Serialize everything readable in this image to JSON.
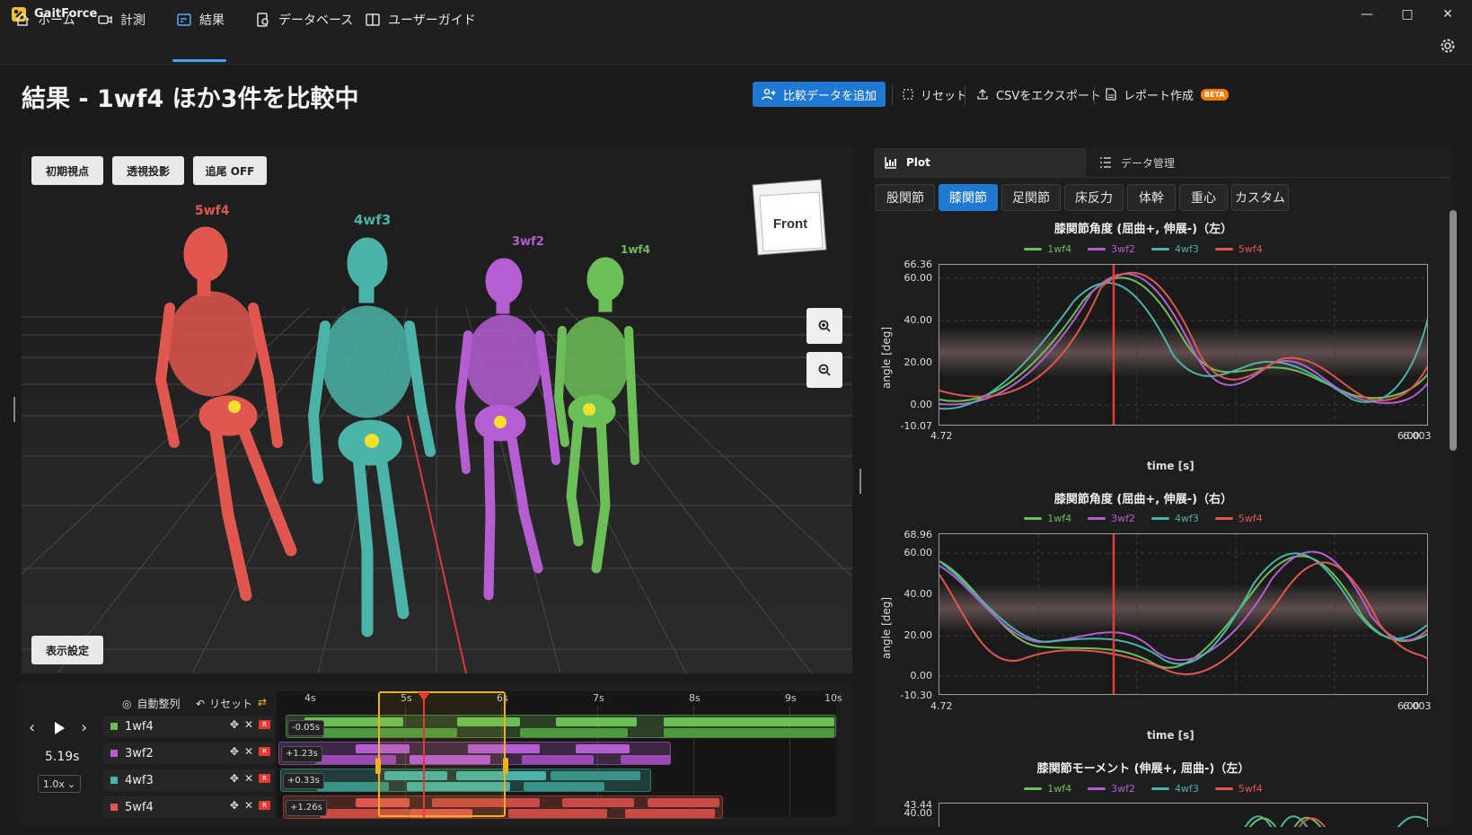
{
  "app": {
    "title": "GaitForce"
  },
  "nav": {
    "home": "ホーム",
    "measure": "計測",
    "results": "結果",
    "database": "データベース",
    "guide": "ユーザーガイド"
  },
  "header": {
    "title": "結果 - 1wf4 ほか3件を比較中",
    "add_compare": "比較データを追加",
    "reset": "リセット",
    "export_csv": "CSVをエクスポート",
    "report": "レポート作成",
    "beta": "BETA"
  },
  "viewport": {
    "initial_view": "初期視点",
    "perspective": "透視投影",
    "follow": "追尾 OFF",
    "display_settings": "表示設定",
    "view_cube_label": "Front",
    "skeletons": [
      {
        "name": "5wf4",
        "color": "#e0574f"
      },
      {
        "name": "4wf3",
        "color": "#4bb3a7"
      },
      {
        "name": "3wf2",
        "color": "#b45ed1"
      },
      {
        "name": "1wf4",
        "color": "#6cbf58"
      }
    ]
  },
  "timeline": {
    "auto_align": "自動整列",
    "reset": "リセット",
    "time": "5.19s",
    "speed": "1.0x",
    "ticks": [
      "4s",
      "5s",
      "6s",
      "7s",
      "8s",
      "9s",
      "10s"
    ],
    "rows": [
      {
        "name": "1wf4",
        "offset": "-0.05s",
        "color": "#6cbf58"
      },
      {
        "name": "3wf2",
        "offset": "+1.23s",
        "color": "#b45ed1"
      },
      {
        "name": "4wf3",
        "offset": "+0.33s",
        "color": "#4bb3a7"
      },
      {
        "name": "5wf4",
        "offset": "+1.26s",
        "color": "#e0574f"
      }
    ],
    "r_badge": "R"
  },
  "panel": {
    "tab_plot": "Plot",
    "tab_data": "データ管理",
    "joints": [
      "股関節",
      "膝関節",
      "足関節",
      "床反力",
      "体幹",
      "重心",
      "カスタム"
    ],
    "active_joint": "膝関節"
  },
  "plots": [
    {
      "title": "膝関節角度 (屈曲+, 伸展-)（左）",
      "ylabel": "angle [deg]",
      "xlabel": "time [s]",
      "yticks": [
        "66.36",
        "60.00",
        "40.00",
        "20.00",
        "0.00",
        "-10.07"
      ],
      "xticks_left": "4.72",
      "xticks_right": "6.003",
      "xticks_overlap": "6.00"
    },
    {
      "title": "膝関節角度 (屈曲+, 伸展-)（右）",
      "ylabel": "angle [deg]",
      "xlabel": "time [s]",
      "yticks": [
        "68.96",
        "60.00",
        "40.00",
        "20.00",
        "0.00",
        "-10.30"
      ],
      "xticks_left": "4.72",
      "xticks_right": "6.003",
      "xticks_overlap": "6.00"
    },
    {
      "title": "膝関節モーメント (伸展+, 屈曲-)（左）",
      "yticks": [
        "43.44",
        "40.00"
      ]
    }
  ],
  "legend": [
    {
      "name": "1wf4",
      "color": "#6cbf58"
    },
    {
      "name": "3wf2",
      "color": "#b45ed1"
    },
    {
      "name": "4wf3",
      "color": "#4bb3a7"
    },
    {
      "name": "5wf4",
      "color": "#e0574f"
    }
  ]
}
